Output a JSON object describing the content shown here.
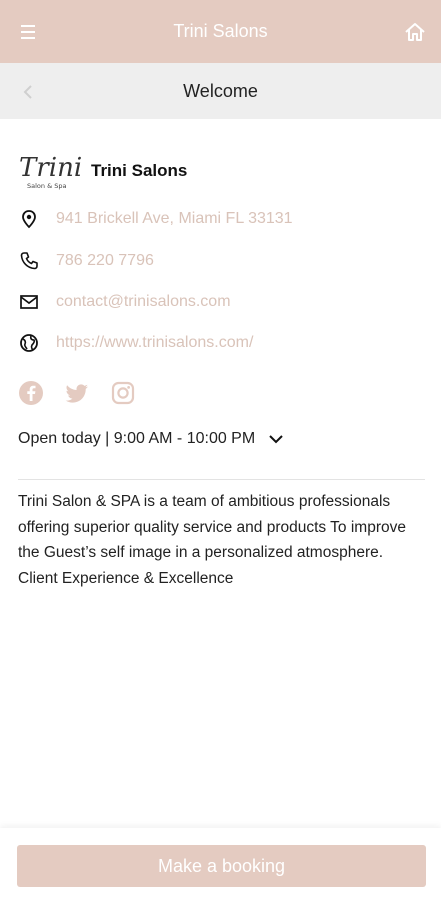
{
  "colors": {
    "accent": "#e4cbc1",
    "link_text": "#d9c3b9",
    "subbar_bg": "#eeeeee"
  },
  "header": {
    "title": "Trini Salons",
    "menu_icon": "hamburger-icon",
    "home_icon": "home-icon"
  },
  "subheader": {
    "title": "Welcome",
    "back_icon": "chevron-left-icon"
  },
  "business": {
    "name": "Trini Salons",
    "logo_text": "Trini",
    "logo_subtext": "Salon & Spa",
    "address": "941 Brickell Ave, Miami FL 33131",
    "phone": "786 220 7796",
    "email": "contact@trinisalons.com",
    "website": "https://www.trinisalons.com/"
  },
  "social": [
    "facebook-icon",
    "twitter-icon",
    "instagram-icon"
  ],
  "hours": {
    "text": "Open today | 9:00 AM - 10:00 PM"
  },
  "description": "Trini Salon & SPA is a team of ambitious professionals offering superior quality service and products To improve the Guest’s self image in a personalized atmosphere. Client Experience & Excellence",
  "booking": {
    "label": "Make a booking"
  }
}
